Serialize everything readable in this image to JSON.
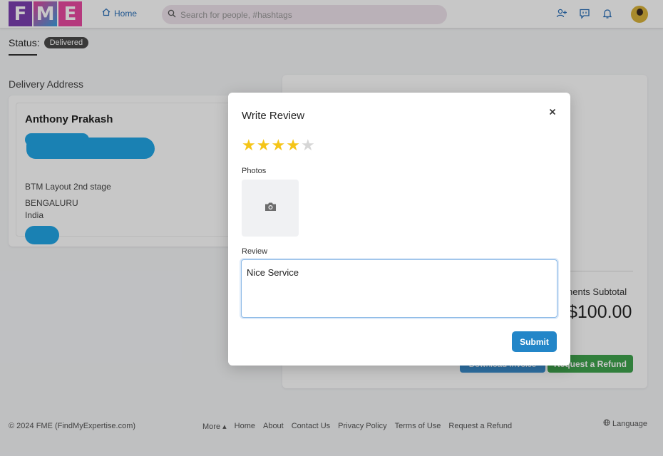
{
  "header": {
    "logo_letters": [
      "F",
      "M",
      "E"
    ],
    "home_label": "Home",
    "search_placeholder": "Search for people, #hashtags"
  },
  "order": {
    "status_label": "Status:",
    "status_value": "Delivered",
    "delivery_address_title": "Delivery Address",
    "address": {
      "name": "Anthony Prakash",
      "line1": "BTM Layout 2nd stage",
      "city": "BENGALURU",
      "country": "India"
    },
    "subtotal_label": "nents Subtotal",
    "subtotal_value": "$100.00",
    "invoice_button": "Download Invoice",
    "refund_button": "Request a Refund"
  },
  "modal": {
    "title": "Write Review",
    "rating": 4,
    "rating_max": 5,
    "photos_label": "Photos",
    "review_label": "Review",
    "review_value": "Nice Service",
    "submit_label": "Submit",
    "close_icon": "close-icon",
    "camera_icon": "camera-icon"
  },
  "footer": {
    "copyright": "© 2024 FME (FindMyExpertise.com)",
    "links": [
      "More ▴",
      "Home",
      "About",
      "Contact Us",
      "Privacy Policy",
      "Terms of Use",
      "Request a Refund"
    ],
    "language_label": "Language"
  },
  "colors": {
    "accent_blue": "#2386c8",
    "star_gold": "#f5c518",
    "refund_green": "#3fa34d",
    "status_badge": "#4a4a4a"
  }
}
